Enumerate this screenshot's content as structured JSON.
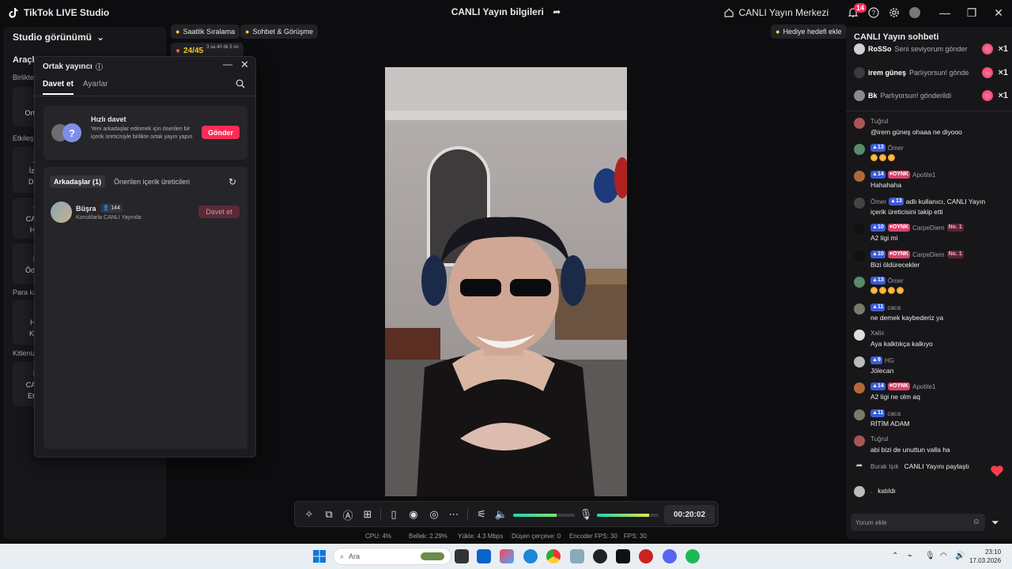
{
  "app": {
    "title": "TikTok LIVE Studio",
    "live_info_title": "CANLI Yayın bilgileri",
    "live_center": "CANLI Yayın Merkezi",
    "notification_count": "14"
  },
  "left": {
    "studio_view": "Studio görünümü",
    "tools": "Araçl",
    "sections": [
      "Birlikte",
      "Etkileşi",
      "Para ka",
      "Kitlenizi"
    ],
    "cards": [
      {
        "line1": "Ortak y",
        "line2": ""
      },
      {
        "line1": "İzley",
        "line2": "Dilek"
      },
      {
        "line1": "CANLI",
        "line2": "Hed"
      },
      {
        "line1": "Ödül Ç",
        "line2": ""
      },
      {
        "line1": "Hay",
        "line2": "Kulü"
      },
      {
        "line1": "CANLI",
        "line2": "Etkinl"
      }
    ]
  },
  "chips": {
    "hourly": "Saatlik Sıralama",
    "chat_meet": "Sohbet & Görüşme",
    "gift_goal": "Hediye hedefi ekle",
    "counter": "24/45",
    "counter_time": "3 sa 40 dk 5 sn"
  },
  "popup": {
    "title": "Ortak yayıncı",
    "tabs": [
      "Davet et",
      "Ayarlar"
    ],
    "quick_title": "Hızlı davet",
    "quick_desc": "Yeni arkadaşlar edinmek için önerilen bir içerik üreticisiyle birlikte ortak yayın yapın",
    "send": "Gönder",
    "friend_tabs": [
      "Arkadaşlar (1)",
      "Önerilen içerik üreticileri"
    ],
    "friend": {
      "name": "Büşra",
      "followers": "144",
      "status": "Konuklarla CANLI Yayında",
      "invite": "Davet et"
    }
  },
  "controls": {
    "timer": "00:20:02",
    "volume_level": 0.7,
    "mic_level": 0.85
  },
  "stats": {
    "cpu": "CPU:  4%",
    "memory": "Bellek:  2.29%",
    "upload": "Yükle:  4.3 Mbps",
    "dropped": "Düşen çerçeve:  0",
    "encoder_fps": "Encoder FPS:  30",
    "fps": "FPS:  30"
  },
  "chat": {
    "title": "CANLI Yayın sohbeti",
    "gifts": [
      {
        "user": "RoSSo",
        "msg": "Seni seviyorum gönder",
        "count": "×1"
      },
      {
        "user": "irem güneş",
        "msg": "Parlıyorsun! gönde",
        "count": "×1"
      },
      {
        "user": "Bk",
        "msg": "Parlıyorsun! gönderildi",
        "count": "×1"
      }
    ],
    "messages": [
      {
        "user": "Tuğrul",
        "text": "@irem güneş ohaaa ne diyooo"
      },
      {
        "level": "13",
        "user": "Ömer",
        "text": ""
      },
      {
        "level": "14",
        "fan": "OYNK",
        "user": "Apotite1",
        "text": "Hahahaha"
      },
      {
        "user": "Ömer",
        "level": "13",
        "text1": "adlı kullanıcı, CANLI Yayın",
        "text": "içerik üreticisini takip etti"
      },
      {
        "level": "10",
        "fan": "OYNK",
        "user": "CarpeDiem",
        "no1": "No. 1",
        "text": "A2 ligi mi"
      },
      {
        "level": "10",
        "fan": "OYNK",
        "user": "CarpeDiem",
        "no1": "No. 1",
        "text": "Bizi öldürecekler"
      },
      {
        "level": "13",
        "user": "Ömer",
        "text": ""
      },
      {
        "level": "11",
        "user": "caca",
        "text": "ne demek kaybederiz ya"
      },
      {
        "user": "Xalix",
        "text": "Aya kalktıkça kalkıyo"
      },
      {
        "level": "9",
        "user": "HG",
        "text": "Jölecan"
      },
      {
        "level": "14",
        "fan": "OYNK",
        "user": "Apotite1",
        "text": "A2 ligi ne olm aq"
      },
      {
        "level": "11",
        "user": "caca",
        "text": "RİTİM ADAM"
      },
      {
        "user": "Tuğrul",
        "text": "abi bizi de unuttun valla ha"
      }
    ],
    "share": {
      "user": "Burak Işık",
      "text": "CANLI Yayını paylaştı"
    },
    "joined": {
      "user": ".",
      "text": "katıldı"
    },
    "comment_placeholder": "Yorum ekle"
  },
  "taskbar": {
    "search": "Ara",
    "time": "23:10",
    "date": "17.03.2026"
  }
}
